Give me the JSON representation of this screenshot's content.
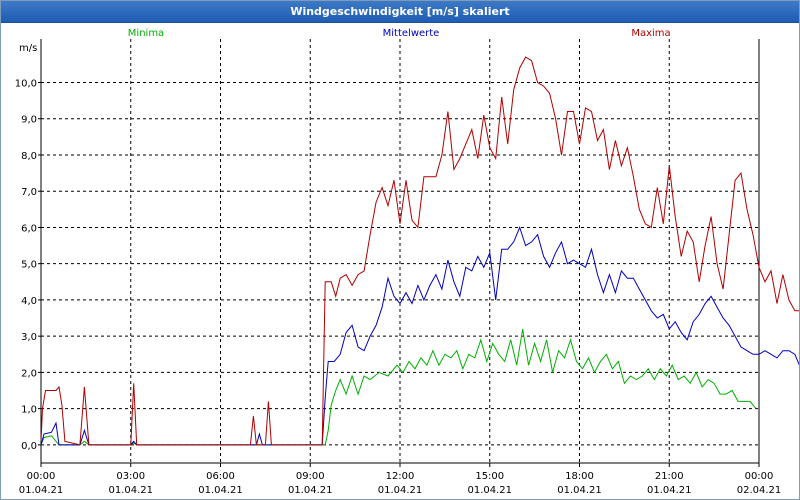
{
  "window": {
    "title": "Windgeschwindigkeit [m/s] skaliert"
  },
  "chart_data": {
    "type": "line",
    "title": "Windgeschwindigkeit [m/s] skaliert",
    "ylabel": "m/s",
    "xlabel": "",
    "ylim": [
      -0.5,
      11.2
    ],
    "xlim_hours": [
      0,
      24
    ],
    "grid": true,
    "legend_position": "top",
    "y_ticks": [
      "0,0",
      "1,0",
      "2,0",
      "3,0",
      "4,0",
      "5,0",
      "6,0",
      "7,0",
      "8,0",
      "9,0",
      "10,0"
    ],
    "x_ticks": [
      {
        "time": "00:00",
        "date": "01.04.21"
      },
      {
        "time": "03:00",
        "date": "01.04.21"
      },
      {
        "time": "06:00",
        "date": "01.04.21"
      },
      {
        "time": "09:00",
        "date": "01.04.21"
      },
      {
        "time": "12:00",
        "date": "01.04.21"
      },
      {
        "time": "15:00",
        "date": "01.04.21"
      },
      {
        "time": "18:00",
        "date": "01.04.21"
      },
      {
        "time": "21:00",
        "date": "01.04.21"
      },
      {
        "time": "00:00",
        "date": "02.04.21"
      }
    ],
    "series": [
      {
        "name": "Minima",
        "color": "#00b000",
        "points": [
          [
            0,
            0
          ],
          [
            0.1,
            0.2
          ],
          [
            0.35,
            0.25
          ],
          [
            0.6,
            0
          ],
          [
            1.3,
            0
          ],
          [
            1.45,
            0.1
          ],
          [
            1.6,
            0
          ],
          [
            3.0,
            0
          ],
          [
            3.1,
            0.05
          ],
          [
            3.2,
            0
          ],
          [
            9.5,
            0
          ],
          [
            9.6,
            0.4
          ],
          [
            9.7,
            1.1
          ],
          [
            9.85,
            1.5
          ],
          [
            10.0,
            1.8
          ],
          [
            10.2,
            1.4
          ],
          [
            10.4,
            1.9
          ],
          [
            10.6,
            1.4
          ],
          [
            10.8,
            1.9
          ],
          [
            11.0,
            1.8
          ],
          [
            11.3,
            2.0
          ],
          [
            11.6,
            1.9
          ],
          [
            11.9,
            2.2
          ],
          [
            12.1,
            2.0
          ],
          [
            12.3,
            2.3
          ],
          [
            12.5,
            2.1
          ],
          [
            12.7,
            2.4
          ],
          [
            12.9,
            2.2
          ],
          [
            13.1,
            2.6
          ],
          [
            13.3,
            2.2
          ],
          [
            13.5,
            2.5
          ],
          [
            13.7,
            2.4
          ],
          [
            13.9,
            2.6
          ],
          [
            14.1,
            2.1
          ],
          [
            14.3,
            2.5
          ],
          [
            14.5,
            2.4
          ],
          [
            14.7,
            2.9
          ],
          [
            14.9,
            2.3
          ],
          [
            15.1,
            2.8
          ],
          [
            15.3,
            2.5
          ],
          [
            15.5,
            2.3
          ],
          [
            15.7,
            2.9
          ],
          [
            15.9,
            2.2
          ],
          [
            16.1,
            3.2
          ],
          [
            16.3,
            2.2
          ],
          [
            16.5,
            2.8
          ],
          [
            16.7,
            2.3
          ],
          [
            16.9,
            2.9
          ],
          [
            17.1,
            2.0
          ],
          [
            17.3,
            2.6
          ],
          [
            17.5,
            2.4
          ],
          [
            17.7,
            2.9
          ],
          [
            17.9,
            2.3
          ],
          [
            18.1,
            2.1
          ],
          [
            18.3,
            2.4
          ],
          [
            18.5,
            2.0
          ],
          [
            18.7,
            2.3
          ],
          [
            18.9,
            2.5
          ],
          [
            19.1,
            2.1
          ],
          [
            19.3,
            2.3
          ],
          [
            19.5,
            1.7
          ],
          [
            19.7,
            1.9
          ],
          [
            19.9,
            1.8
          ],
          [
            20.1,
            1.9
          ],
          [
            20.3,
            2.1
          ],
          [
            20.5,
            1.8
          ],
          [
            20.7,
            2.1
          ],
          [
            20.9,
            1.9
          ],
          [
            21.1,
            2.2
          ],
          [
            21.3,
            1.8
          ],
          [
            21.5,
            1.9
          ],
          [
            21.7,
            1.7
          ],
          [
            21.9,
            2.0
          ],
          [
            22.1,
            1.6
          ],
          [
            22.3,
            1.8
          ],
          [
            22.5,
            1.7
          ],
          [
            22.7,
            1.4
          ],
          [
            22.9,
            1.4
          ],
          [
            23.1,
            1.5
          ],
          [
            23.3,
            1.2
          ],
          [
            23.5,
            1.2
          ],
          [
            23.7,
            1.2
          ],
          [
            23.9,
            1.0
          ]
        ]
      },
      {
        "name": "Mittelwerte",
        "color": "#0000c0",
        "points": [
          [
            0,
            0
          ],
          [
            0.1,
            0.3
          ],
          [
            0.35,
            0.35
          ],
          [
            0.5,
            0.6
          ],
          [
            0.6,
            0
          ],
          [
            1.3,
            0
          ],
          [
            1.45,
            0.4
          ],
          [
            1.6,
            0
          ],
          [
            3.0,
            0
          ],
          [
            3.1,
            0.1
          ],
          [
            3.2,
            0
          ],
          [
            7.2,
            0
          ],
          [
            7.3,
            0.3
          ],
          [
            7.4,
            0
          ],
          [
            9.4,
            0
          ],
          [
            9.5,
            1.3
          ],
          [
            9.6,
            2.3
          ],
          [
            9.8,
            2.3
          ],
          [
            10.0,
            2.5
          ],
          [
            10.2,
            3.1
          ],
          [
            10.4,
            3.3
          ],
          [
            10.6,
            2.7
          ],
          [
            10.8,
            2.6
          ],
          [
            11.0,
            3.0
          ],
          [
            11.2,
            3.3
          ],
          [
            11.4,
            3.8
          ],
          [
            11.6,
            4.6
          ],
          [
            11.8,
            4.1
          ],
          [
            12.0,
            3.9
          ],
          [
            12.2,
            4.2
          ],
          [
            12.4,
            3.9
          ],
          [
            12.6,
            4.4
          ],
          [
            12.8,
            4.0
          ],
          [
            13.0,
            4.4
          ],
          [
            13.2,
            4.7
          ],
          [
            13.4,
            4.3
          ],
          [
            13.6,
            5.1
          ],
          [
            13.8,
            4.5
          ],
          [
            14.0,
            4.1
          ],
          [
            14.2,
            4.9
          ],
          [
            14.4,
            4.8
          ],
          [
            14.6,
            5.2
          ],
          [
            14.8,
            4.9
          ],
          [
            15.0,
            5.3
          ],
          [
            15.2,
            4.0
          ],
          [
            15.4,
            5.4
          ],
          [
            15.6,
            5.4
          ],
          [
            15.8,
            5.6
          ],
          [
            16.0,
            6.0
          ],
          [
            16.2,
            5.5
          ],
          [
            16.4,
            5.6
          ],
          [
            16.6,
            5.8
          ],
          [
            16.8,
            5.2
          ],
          [
            17.0,
            4.9
          ],
          [
            17.2,
            5.3
          ],
          [
            17.4,
            5.6
          ],
          [
            17.6,
            5.0
          ],
          [
            17.8,
            5.1
          ],
          [
            18.0,
            5.0
          ],
          [
            18.2,
            4.9
          ],
          [
            18.4,
            5.4
          ],
          [
            18.6,
            4.7
          ],
          [
            18.8,
            4.2
          ],
          [
            19.0,
            4.7
          ],
          [
            19.2,
            4.2
          ],
          [
            19.4,
            4.8
          ],
          [
            19.6,
            4.6
          ],
          [
            19.8,
            4.6
          ],
          [
            20.0,
            4.3
          ],
          [
            20.2,
            4.0
          ],
          [
            20.4,
            3.7
          ],
          [
            20.6,
            3.5
          ],
          [
            20.8,
            3.6
          ],
          [
            21.0,
            3.2
          ],
          [
            21.2,
            3.4
          ],
          [
            21.4,
            3.1
          ],
          [
            21.6,
            2.9
          ],
          [
            21.8,
            3.4
          ],
          [
            22.0,
            3.6
          ],
          [
            22.2,
            3.9
          ],
          [
            22.4,
            4.1
          ],
          [
            22.6,
            3.8
          ],
          [
            22.8,
            3.5
          ],
          [
            23.0,
            3.3
          ],
          [
            23.2,
            3.0
          ],
          [
            23.4,
            2.7
          ],
          [
            23.6,
            2.6
          ],
          [
            23.8,
            2.5
          ],
          [
            24.0,
            2.5
          ],
          [
            24.2,
            2.6
          ],
          [
            24.4,
            2.5
          ],
          [
            24.6,
            2.4
          ],
          [
            24.8,
            2.6
          ],
          [
            25.0,
            2.6
          ],
          [
            25.2,
            2.5
          ],
          [
            25.4,
            2.1
          ],
          [
            25.6,
            2.3
          ]
        ]
      },
      {
        "name": "Maxima",
        "color": "#b00000",
        "points": [
          [
            0,
            0.1
          ],
          [
            0.05,
            1.0
          ],
          [
            0.15,
            1.5
          ],
          [
            0.5,
            1.5
          ],
          [
            0.6,
            1.6
          ],
          [
            0.7,
            1.1
          ],
          [
            0.8,
            0.1
          ],
          [
            1.3,
            0
          ],
          [
            1.45,
            1.6
          ],
          [
            1.6,
            0
          ],
          [
            3.0,
            0
          ],
          [
            3.1,
            1.7
          ],
          [
            3.2,
            0
          ],
          [
            7.0,
            0
          ],
          [
            7.1,
            0.8
          ],
          [
            7.2,
            0
          ],
          [
            7.5,
            0
          ],
          [
            7.6,
            1.2
          ],
          [
            7.7,
            0
          ],
          [
            9.4,
            0
          ],
          [
            9.5,
            4.5
          ],
          [
            9.7,
            4.5
          ],
          [
            9.85,
            4.1
          ],
          [
            10.0,
            4.6
          ],
          [
            10.2,
            4.7
          ],
          [
            10.4,
            4.4
          ],
          [
            10.6,
            4.7
          ],
          [
            10.8,
            4.8
          ],
          [
            11.0,
            5.8
          ],
          [
            11.2,
            6.7
          ],
          [
            11.4,
            7.1
          ],
          [
            11.6,
            6.6
          ],
          [
            11.8,
            7.3
          ],
          [
            12.0,
            6.1
          ],
          [
            12.2,
            7.3
          ],
          [
            12.4,
            6.2
          ],
          [
            12.6,
            6.0
          ],
          [
            12.8,
            7.4
          ],
          [
            13.0,
            7.4
          ],
          [
            13.2,
            7.4
          ],
          [
            13.4,
            8.0
          ],
          [
            13.6,
            9.2
          ],
          [
            13.8,
            7.6
          ],
          [
            14.0,
            7.9
          ],
          [
            14.2,
            8.3
          ],
          [
            14.4,
            8.7
          ],
          [
            14.6,
            7.9
          ],
          [
            14.8,
            9.1
          ],
          [
            15.0,
            8.2
          ],
          [
            15.2,
            7.9
          ],
          [
            15.4,
            9.6
          ],
          [
            15.6,
            8.3
          ],
          [
            15.8,
            9.8
          ],
          [
            16.0,
            10.4
          ],
          [
            16.2,
            10.7
          ],
          [
            16.4,
            10.6
          ],
          [
            16.6,
            10.0
          ],
          [
            16.8,
            9.9
          ],
          [
            17.0,
            9.7
          ],
          [
            17.2,
            9.0
          ],
          [
            17.4,
            8.0
          ],
          [
            17.6,
            9.2
          ],
          [
            17.8,
            9.2
          ],
          [
            18.0,
            8.3
          ],
          [
            18.2,
            9.3
          ],
          [
            18.4,
            9.2
          ],
          [
            18.6,
            8.4
          ],
          [
            18.8,
            8.7
          ],
          [
            19.0,
            7.6
          ],
          [
            19.2,
            8.4
          ],
          [
            19.4,
            7.7
          ],
          [
            19.6,
            8.2
          ],
          [
            19.8,
            7.4
          ],
          [
            20.0,
            6.5
          ],
          [
            20.2,
            6.1
          ],
          [
            20.4,
            6.0
          ],
          [
            20.6,
            7.1
          ],
          [
            20.8,
            6.1
          ],
          [
            21.0,
            7.7
          ],
          [
            21.2,
            6.3
          ],
          [
            21.4,
            5.2
          ],
          [
            21.6,
            5.9
          ],
          [
            21.8,
            5.6
          ],
          [
            22.0,
            4.5
          ],
          [
            22.2,
            5.5
          ],
          [
            22.4,
            6.3
          ],
          [
            22.6,
            5.0
          ],
          [
            22.8,
            4.3
          ],
          [
            23.0,
            5.8
          ],
          [
            23.2,
            7.3
          ],
          [
            23.4,
            7.5
          ],
          [
            23.6,
            6.5
          ],
          [
            23.8,
            5.8
          ],
          [
            24.0,
            4.9
          ],
          [
            24.2,
            4.5
          ],
          [
            24.4,
            4.8
          ],
          [
            24.6,
            3.9
          ],
          [
            24.8,
            4.7
          ],
          [
            25.0,
            4.0
          ],
          [
            25.2,
            3.7
          ],
          [
            25.4,
            3.7
          ],
          [
            25.6,
            4.2
          ],
          [
            25.8,
            4.4
          ],
          [
            26.0,
            3.5
          ],
          [
            26.2,
            4.3
          ]
        ]
      }
    ]
  }
}
